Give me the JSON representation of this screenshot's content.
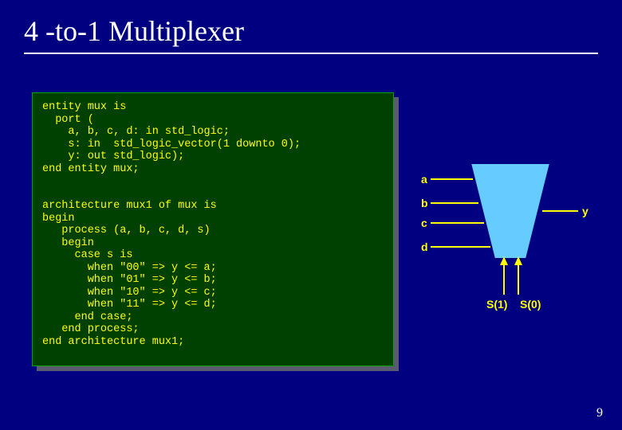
{
  "title": "4 -to-1 Multiplexer",
  "slide_number": "9",
  "code": {
    "block1": "entity mux is\n  port (\n    a, b, c, d: in std_logic;\n    s: in  std_logic_vector(1 downto 0);\n    y: out std_logic);\nend entity mux;",
    "block2": "architecture mux1 of mux is\nbegin\n   process (a, b, c, d, s)\n   begin\n     case s is\n       when \"00\" => y <= a;\n       when \"01\" => y <= b;\n       when \"10\" => y <= c;\n       when \"11\" => y <= d;\n     end case;\n   end process;\nend architecture mux1;"
  },
  "pins": {
    "a": "a",
    "b": "b",
    "c": "c",
    "d": "d",
    "y": "y",
    "s1": "S(1)",
    "s0": "S(0)"
  }
}
